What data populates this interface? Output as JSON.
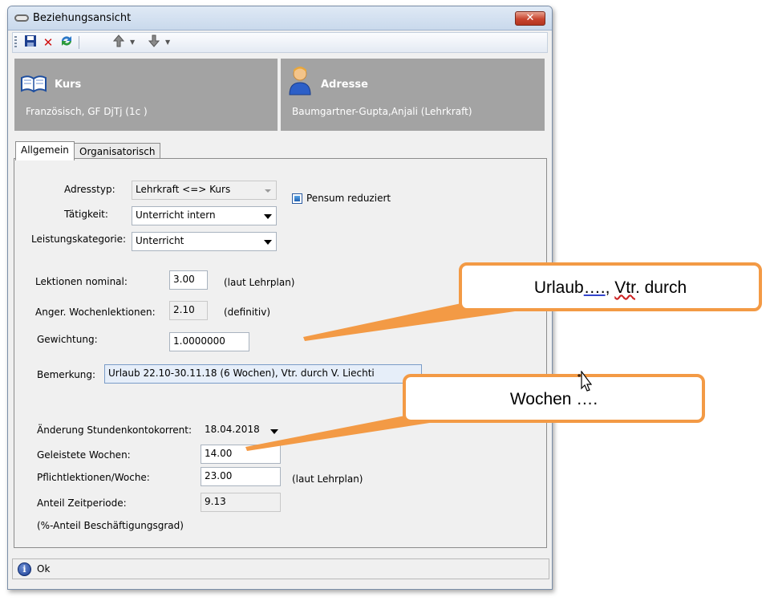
{
  "window": {
    "title": "Beziehungsansicht",
    "close_label": "✕"
  },
  "toolbar": {
    "save_icon": "save-icon",
    "delete_icon": "delete-icon",
    "refresh_icon": "refresh-icon",
    "up_icon": "arrow-up-icon",
    "down_icon": "arrow-down-icon"
  },
  "header": {
    "left": {
      "title": "Kurs",
      "subtitle": "Französisch, GF DjTj (1c )"
    },
    "right": {
      "title": "Adresse",
      "subtitle": "Baumgartner-Gupta,Anjali (Lehrkraft)"
    }
  },
  "tabs": [
    {
      "label": "Allgemein",
      "active": true
    },
    {
      "label": "Organisatorisch",
      "active": false
    }
  ],
  "form": {
    "adresstyp": {
      "label": "Adresstyp:",
      "value": "Lehrkraft <=> Kurs"
    },
    "pensum": {
      "label": "Pensum reduziert",
      "checked": true
    },
    "taetigkeit": {
      "label": "Tätigkeit:",
      "value": "Unterricht intern"
    },
    "leistungskategorie": {
      "label": "Leistungskategorie:",
      "value": "Unterricht"
    },
    "lektionen_nominal": {
      "label": "Lektionen nominal:",
      "value": "3.00",
      "note": "(laut Lehrplan)"
    },
    "anger_wochenlektionen": {
      "label": "Anger. Wochenlektionen:",
      "value": "2.10",
      "note": "(definitiv)"
    },
    "gewichtung": {
      "label": "Gewichtung:",
      "value": "1.0000000"
    },
    "bemerkung": {
      "label": "Bemerkung:",
      "value": "Urlaub 22.10-30.11.18 (6 Wochen), Vtr. durch V. Liechti"
    },
    "aenderung": {
      "label": "Änderung Stundenkontokorrent:",
      "value": "18.04.2018"
    },
    "geleistete_wochen": {
      "label": "Geleistete Wochen:",
      "value": "14.00"
    },
    "pflichtlektionen": {
      "label": "Pflichtlektionen/Woche:",
      "value": "23.00",
      "note": "(laut Lehrplan)"
    },
    "anteil_zeitperiode": {
      "label": "Anteil Zeitperiode:",
      "value": "9.13"
    },
    "anteil_note": "(%-Anteil Beschäftigungsgrad)"
  },
  "status": {
    "text": "Ok"
  },
  "callouts": {
    "top": {
      "part1": "Urlaub",
      "part2": "….",
      "part3": ", ",
      "part4": "Vtr",
      "part5": ". durch"
    },
    "bottom": {
      "text": "Wochen …."
    }
  },
  "colors": {
    "callout_border": "#f39a45",
    "panel_bg": "#a3a3a3"
  }
}
